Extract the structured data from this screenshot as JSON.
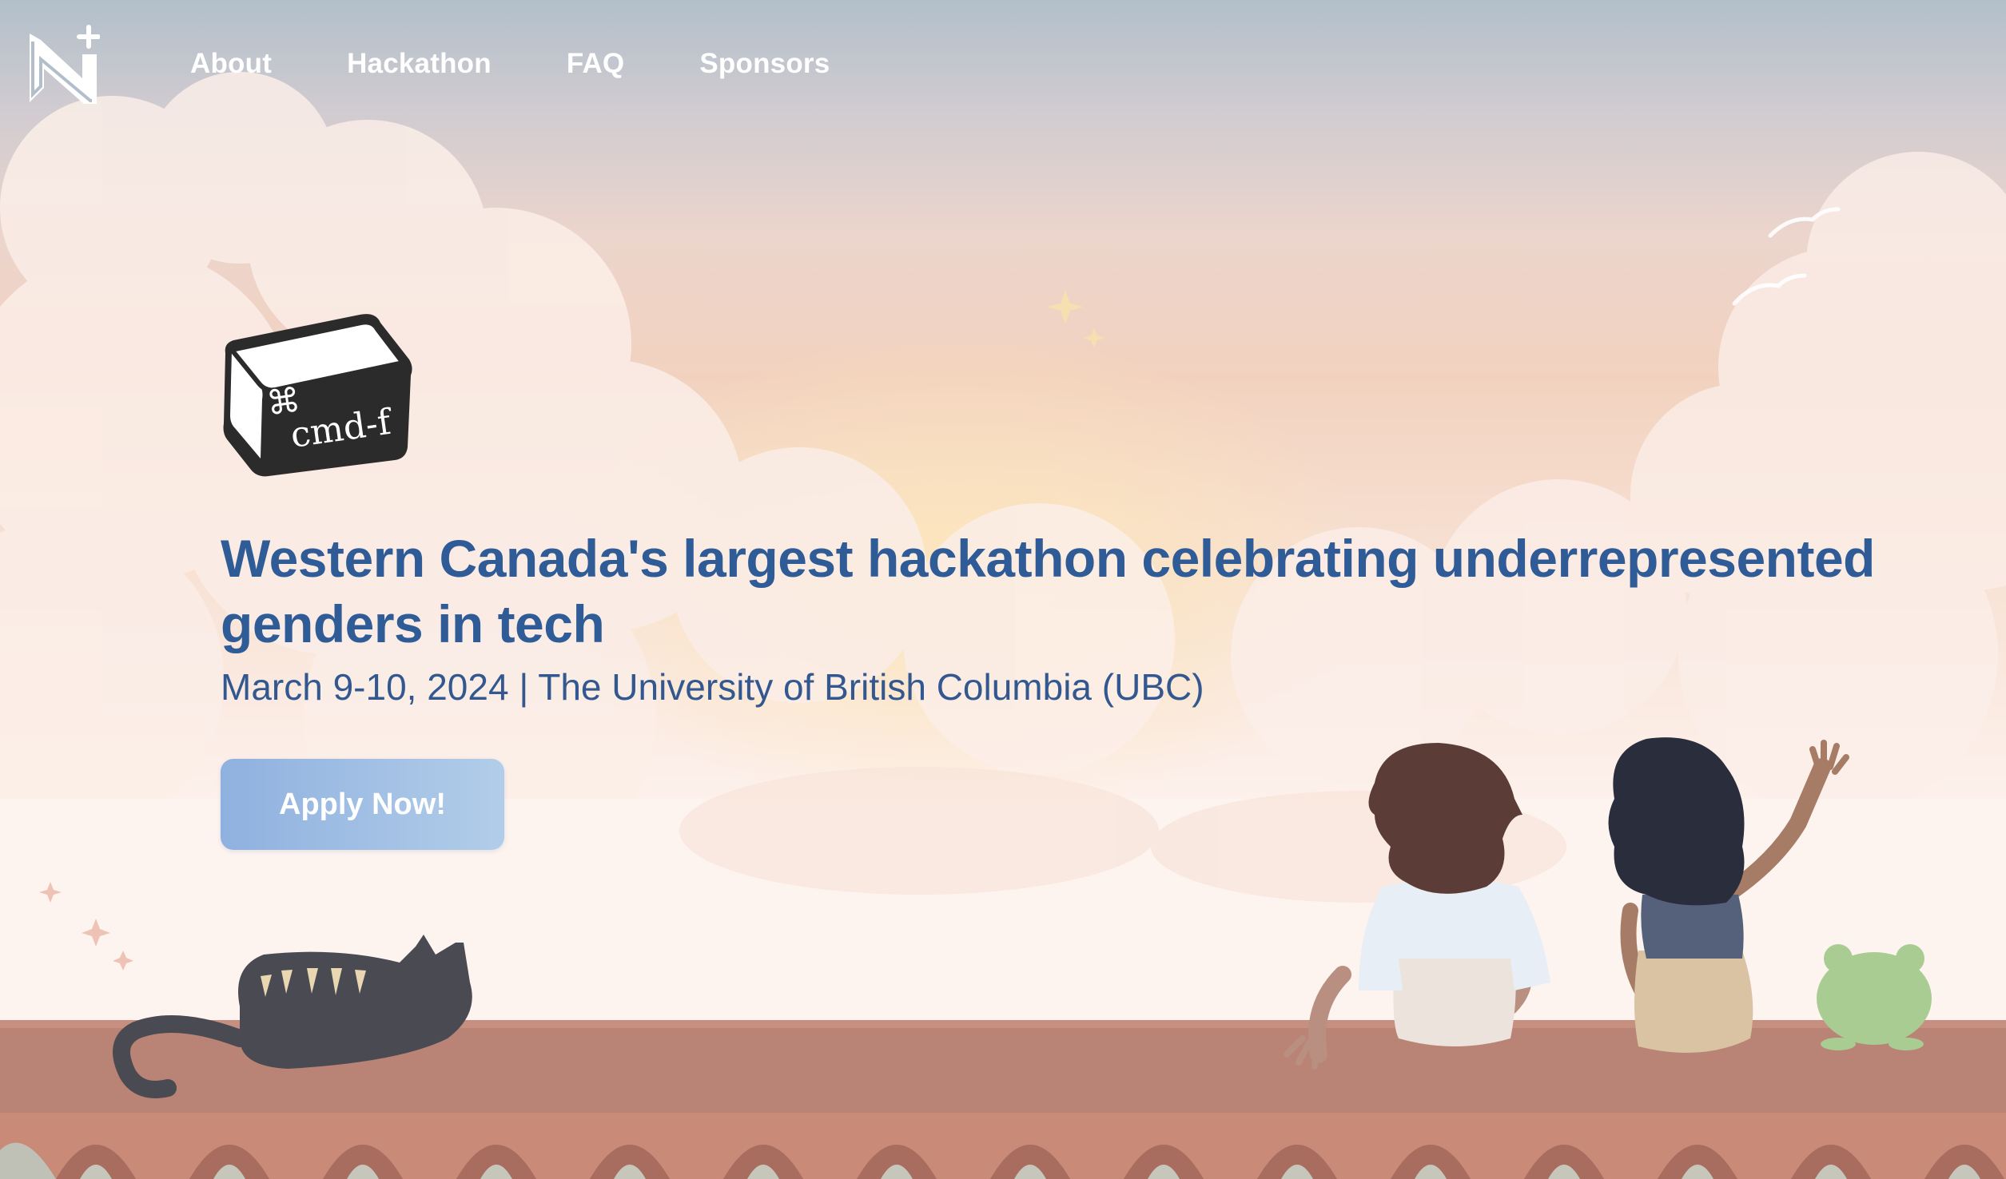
{
  "nav": {
    "logo_icon": "nwplus-logo-icon",
    "links": [
      {
        "label": "About"
      },
      {
        "label": "Hackathon"
      },
      {
        "label": "FAQ"
      },
      {
        "label": "Sponsors"
      }
    ]
  },
  "hero": {
    "badge_text": "cmd-f",
    "badge_symbol": "⌘",
    "headline": "Western Canada's largest hackathon celebrating underrepresented genders in tech",
    "subline": "March 9-10, 2024 | The University of British Columbia (UBC)",
    "cta_label": "Apply Now!"
  },
  "colors": {
    "headline": "#2f5c96",
    "button_start": "#8fb1df",
    "button_end": "#b2cde9",
    "roof": "#b98475"
  },
  "illustration": {
    "items": [
      "cat",
      "girl-brown-hair",
      "girl-dark-hair-waving",
      "frog",
      "birds",
      "sparkles",
      "clouds",
      "rooftop"
    ]
  }
}
